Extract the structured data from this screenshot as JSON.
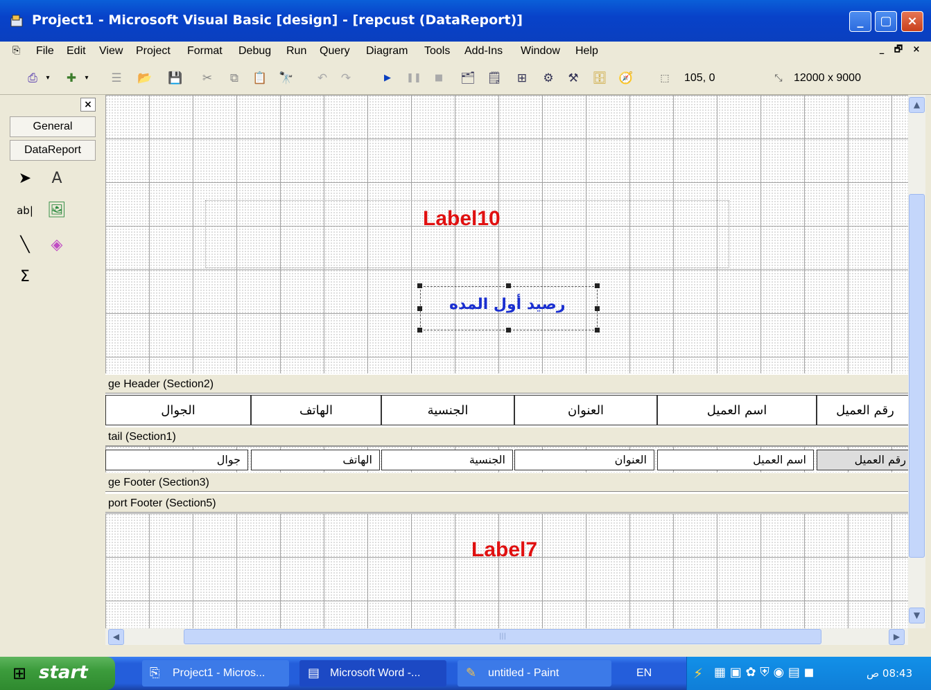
{
  "window": {
    "title": "Project1 - Microsoft Visual Basic [design] - [repcust (DataReport)]"
  },
  "menubar": {
    "items": [
      "File",
      "Edit",
      "View",
      "Project",
      "Format",
      "Debug",
      "Run",
      "Query",
      "Diagram",
      "Tools",
      "Add-Ins",
      "Window",
      "Help"
    ],
    "mdi_buttons": [
      "_",
      "🗗",
      "×"
    ]
  },
  "toolbar": {
    "position_readout": "105, 0",
    "size_readout": "12000 x 9000"
  },
  "toolbox": {
    "close": "×",
    "tabs": [
      "General",
      "DataReport"
    ],
    "tools": [
      "pointer-icon",
      "rpt-label-icon",
      "rpt-textbox-icon",
      "rpt-image-icon",
      "rpt-line-icon",
      "rpt-shape-icon",
      "rpt-function-icon"
    ]
  },
  "designer": {
    "report_header": {
      "label_title": "Label10",
      "label_balance": "رصيد أول المده"
    },
    "sections": {
      "page_header": "ge Header (Section2)",
      "detail": "tail (Section1)",
      "page_footer": "ge Footer (Section3)",
      "report_footer": "port Footer (Section5)"
    },
    "page_header_cells": [
      "الجوال",
      "الهاتف",
      "الجنسية",
      "العنوان",
      "اسم العميل",
      "رقم العميل"
    ],
    "detail_cells": [
      "جوال",
      "الهاتف",
      "الجنسية",
      "العنوان",
      "اسم العميل",
      "رقم العميل"
    ],
    "report_footer": {
      "label": "Label7"
    }
  },
  "colors": {
    "label_red": "#e01010",
    "label_blue": "#1a2fd0",
    "title_blue": "#0842c9"
  },
  "taskbar": {
    "start": "start",
    "tasks": [
      "Project1 - Micros...",
      "Microsoft Word -...",
      "untitled - Paint"
    ],
    "language": "EN",
    "clock": "08:43 ص"
  }
}
